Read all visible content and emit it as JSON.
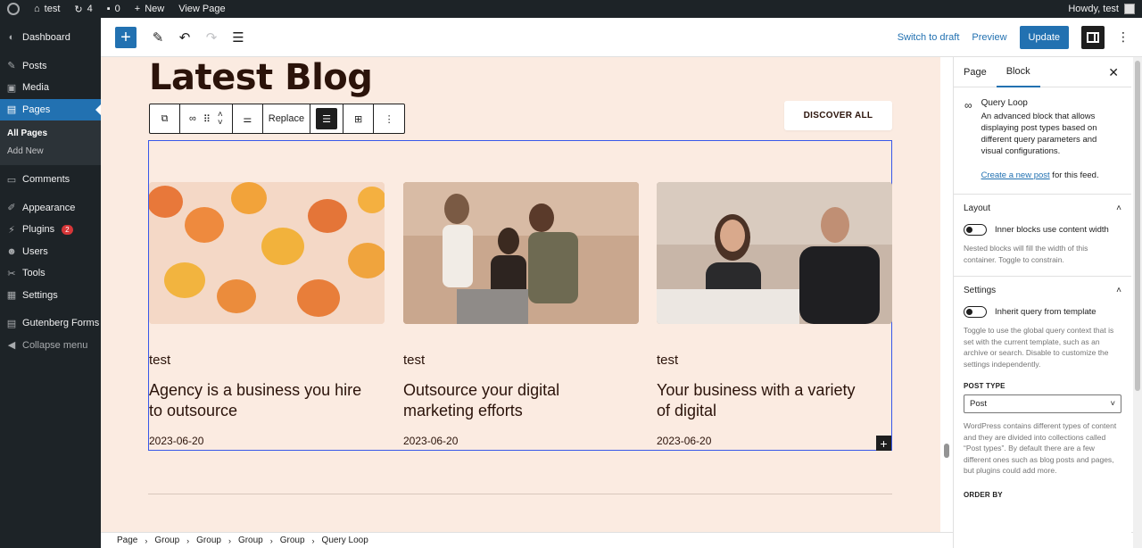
{
  "adminbar": {
    "site": "test",
    "updates": "4",
    "comments": "0",
    "new": "New",
    "view_page": "View Page",
    "howdy": "Howdy, test"
  },
  "sidebar": {
    "items": [
      {
        "label": "Dashboard",
        "icon": "dashboard-icon"
      },
      {
        "label": "Posts",
        "icon": "pin-icon"
      },
      {
        "label": "Media",
        "icon": "media-icon"
      },
      {
        "label": "Pages",
        "icon": "pages-icon"
      },
      {
        "label": "Comments",
        "icon": "comment-icon"
      },
      {
        "label": "Appearance",
        "icon": "brush-icon"
      },
      {
        "label": "Plugins",
        "icon": "plug-icon",
        "badge": "2"
      },
      {
        "label": "Users",
        "icon": "users-icon"
      },
      {
        "label": "Tools",
        "icon": "wrench-icon"
      },
      {
        "label": "Settings",
        "icon": "settings-icon"
      },
      {
        "label": "Gutenberg Forms",
        "icon": "forms-icon"
      },
      {
        "label": "Collapse menu",
        "icon": "collapse-icon"
      }
    ],
    "sub": {
      "all_pages": "All Pages",
      "add_new": "Add New"
    }
  },
  "toolbar": {
    "switch_draft": "Switch to draft",
    "preview": "Preview",
    "update": "Update"
  },
  "canvas": {
    "heading": "Latest Blog",
    "discover": "DISCOVER ALL",
    "replace": "Replace",
    "posts": [
      {
        "author": "test",
        "title": "Agency is a business you hire to outsource",
        "date": "2023-06-20"
      },
      {
        "author": "test",
        "title": "Outsource your digital marketing efforts",
        "date": "2023-06-20"
      },
      {
        "author": "test",
        "title": "Your business with a variety of digital",
        "date": "2023-06-20"
      }
    ]
  },
  "breadcrumb": [
    "Page",
    "Group",
    "Group",
    "Group",
    "Group",
    "Query Loop"
  ],
  "panel": {
    "tab_page": "Page",
    "tab_block": "Block",
    "block_name": "Query Loop",
    "block_desc": "An advanced block that allows displaying post types based on different query parameters and visual configurations.",
    "create_link": "Create a new post",
    "create_tail": " for this feed.",
    "layout_title": "Layout",
    "layout_toggle": "Inner blocks use content width",
    "layout_help": "Nested blocks will fill the width of this container. Toggle to constrain.",
    "settings_title": "Settings",
    "inherit_toggle": "Inherit query from template",
    "inherit_help": "Toggle to use the global query context that is set with the current template, such as an archive or search. Disable to customize the settings independently.",
    "post_type_label": "POST TYPE",
    "post_type_value": "Post",
    "post_type_help": "WordPress contains different types of content and they are divided into collections called “Post types”. By default there are a few different ones such as blog posts and pages, but plugins could add more.",
    "order_by_label": "ORDER BY"
  }
}
